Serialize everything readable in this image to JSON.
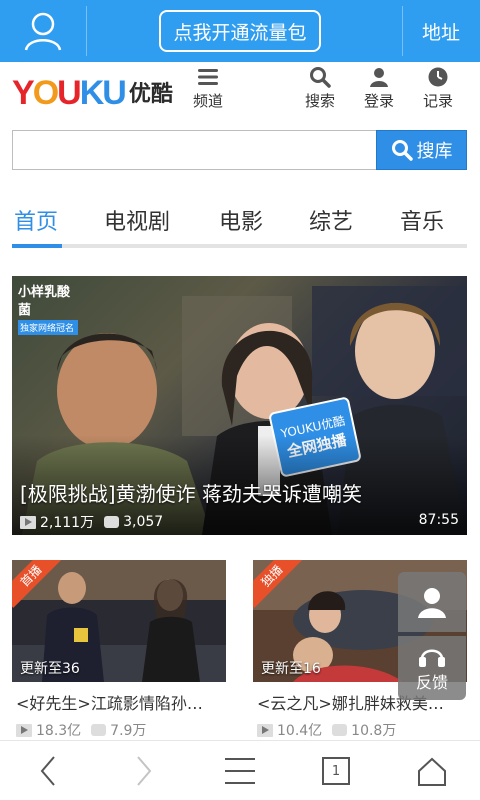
{
  "topbar": {
    "promo_label": "点我开通流量包",
    "address_label": "地址"
  },
  "header": {
    "logo_text": "YOUKU",
    "logo_cn": "优酷",
    "nav": {
      "channels": "频道",
      "search": "搜索",
      "login": "登录",
      "history": "记录"
    }
  },
  "search": {
    "placeholder": "",
    "button_label": "搜库"
  },
  "tabs": [
    "首页",
    "电视剧",
    "电影",
    "综艺",
    "音乐"
  ],
  "hero": {
    "title": "[极限挑战]黄渤使诈 蒋劲夫哭诉遭嘲笑",
    "plays": "2,111万",
    "comments": "3,057",
    "duration": "87:55",
    "show_logo": "小样乳酸菌",
    "show_logo_sub": "独家网络冠名",
    "badge_top": "YOUKU优酷",
    "badge_main": "全网独播"
  },
  "cards": [
    {
      "ribbon": "首播",
      "update": "更新至36",
      "title": "<好先生>江疏影情陷孙…",
      "plays": "18.3亿",
      "comments": "7.9万"
    },
    {
      "ribbon": "独播",
      "update": "更新至16",
      "title": "<云之凡>娜扎胖妹救美…",
      "plays": "10.4亿",
      "comments": "10.8万"
    }
  ],
  "floating": {
    "feedback_label": "反馈"
  },
  "bottom": {
    "tab_count": "1"
  },
  "colors": {
    "accent": "#2f8fe6",
    "topbar": "#2f9df0",
    "ribbon": "#e8502a"
  }
}
